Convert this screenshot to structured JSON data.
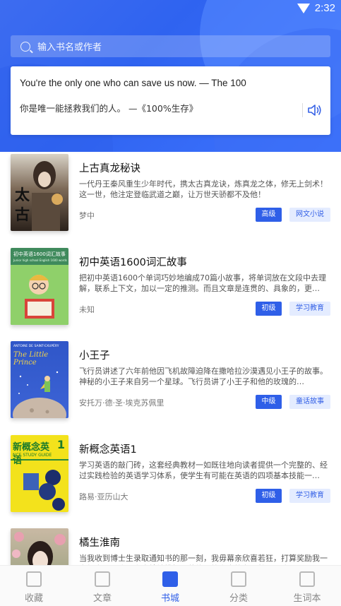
{
  "status": {
    "time": "2:32"
  },
  "search": {
    "placeholder": "输入书名或作者"
  },
  "quote": {
    "english": "You're the only one who can save us now. — The 100",
    "chinese": "你是唯一能拯救我们的人。 —《100%生存》"
  },
  "books": [
    {
      "title": "上古真龙秘诀",
      "desc": "一代丹王秦风重生少年时代，携太古真龙诀，炼真龙之体，修无上剑术！这一世，他注定登临武道之巅，让万世天骄都不及他！",
      "author": "梦中",
      "level": "高级",
      "genre": "网文小说"
    },
    {
      "title": "初中英语1600词汇故事",
      "desc": "把初中英语1600个单词巧妙地编成70篇小故事，将单词放在文段中去理解，联系上下文，加以一定的推测。而且文章是连贯的、具象的，更…",
      "author": "未知",
      "level": "初级",
      "genre": "学习教育"
    },
    {
      "title": "小王子",
      "desc": "飞行员讲述了六年前他因飞机故障迫降在撒哈拉沙漠遇见小王子的故事。神秘的小王子来自另一个星球。飞行员讲了小王子和他的玫瑰的…",
      "author": "安托万·德·圣·埃克苏佩里",
      "level": "中级",
      "genre": "童话故事"
    },
    {
      "title": "新概念英语1",
      "desc": "学习英语的敲门砖，这套经典教材一如既往地向读者提供一个完整的、经过实践检验的英语学习体系，使学生有可能在英语的四项基本技能一…",
      "author": "路易·亚历山大",
      "level": "初级",
      "genre": "学习教育"
    },
    {
      "title": "橘生淮南",
      "desc": "当我收到博士生录取通知书的那一刻，我毋幕亲欣喜若狂，打算奖励我一套新房，而我父亲也特地挑好了装修，筹言先筹车，然而，我…",
      "author": "",
      "level": "",
      "genre": ""
    }
  ],
  "covers": {
    "book1_text": "太古",
    "book2_text": "初中英语1600词汇故事",
    "book2_sub": "Junior high school English 1600 words",
    "book3_author": "ANTOINE DE SAINT-EXUPÉRY",
    "book3_title": "The Little Prince",
    "book4_title": "新概念英语",
    "book4_num": "1",
    "book4_sub": "NCE STUDY GUIDE"
  },
  "tabs": [
    {
      "label": "收藏"
    },
    {
      "label": "文章"
    },
    {
      "label": "书城"
    },
    {
      "label": "分类"
    },
    {
      "label": "生词本"
    }
  ],
  "colors": {
    "accent": "#2f5fe8",
    "genre_bg": "#e4ecff"
  }
}
